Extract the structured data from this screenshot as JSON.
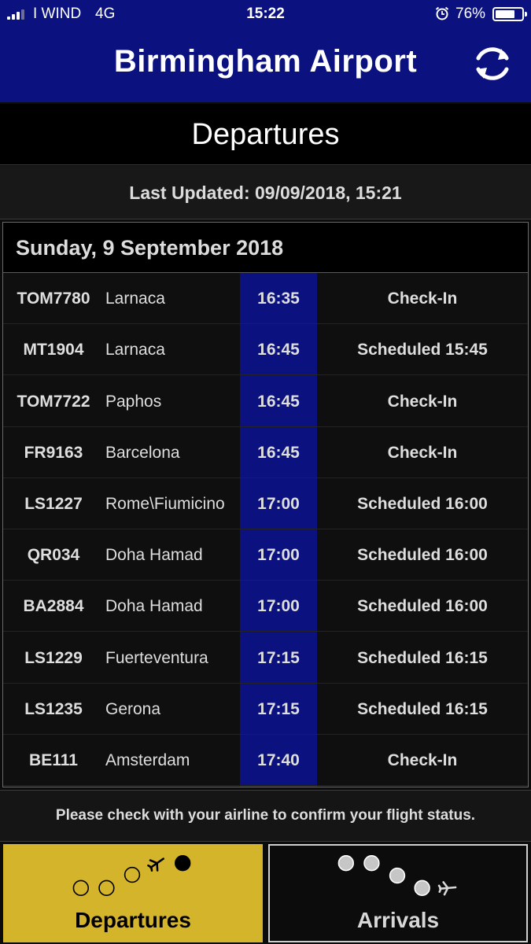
{
  "status_bar": {
    "carrier": "I WIND",
    "network": "4G",
    "time": "15:22",
    "battery_percent": "76%",
    "battery_level": 0.76,
    "alarm_icon": "alarm-clock-icon"
  },
  "header": {
    "title": "Birmingham Airport",
    "refresh_icon": "refresh-icon"
  },
  "section_title": "Departures",
  "last_updated": "Last Updated: 09/09/2018, 15:21",
  "board": {
    "date": "Sunday, 9 September 2018",
    "flights": [
      {
        "flight": "TOM7780",
        "destination": "Larnaca",
        "time": "16:35",
        "status": "Check-In"
      },
      {
        "flight": "MT1904",
        "destination": "Larnaca",
        "time": "16:45",
        "status": "Scheduled 15:45"
      },
      {
        "flight": "TOM7722",
        "destination": "Paphos",
        "time": "16:45",
        "status": "Check-In"
      },
      {
        "flight": "FR9163",
        "destination": "Barcelona",
        "time": "16:45",
        "status": "Check-In"
      },
      {
        "flight": "LS1227",
        "destination": "Rome\\Fiumicino",
        "time": "17:00",
        "status": "Scheduled 16:00"
      },
      {
        "flight": "QR034",
        "destination": "Doha Hamad",
        "time": "17:00",
        "status": "Scheduled 16:00"
      },
      {
        "flight": "BA2884",
        "destination": "Doha Hamad",
        "time": "17:00",
        "status": "Scheduled 16:00"
      },
      {
        "flight": "LS1229",
        "destination": "Fuerteventura",
        "time": "17:15",
        "status": "Scheduled 16:15"
      },
      {
        "flight": "LS1235",
        "destination": "Gerona",
        "time": "17:15",
        "status": "Scheduled 16:15"
      },
      {
        "flight": "BE111",
        "destination": "Amsterdam",
        "time": "17:40",
        "status": "Check-In"
      }
    ]
  },
  "notice": "Please check with your airline to confirm your flight status.",
  "tabs": {
    "departures": {
      "label": "Departures",
      "icon": "takeoff-path-icon",
      "selected": true
    },
    "arrivals": {
      "label": "Arrivals",
      "icon": "landing-path-icon",
      "selected": false
    }
  },
  "colors": {
    "header_bg": "#0b1280",
    "time_band": "#0b1280",
    "active_tab": "#d4b42b",
    "background": "#0c0c0c"
  }
}
